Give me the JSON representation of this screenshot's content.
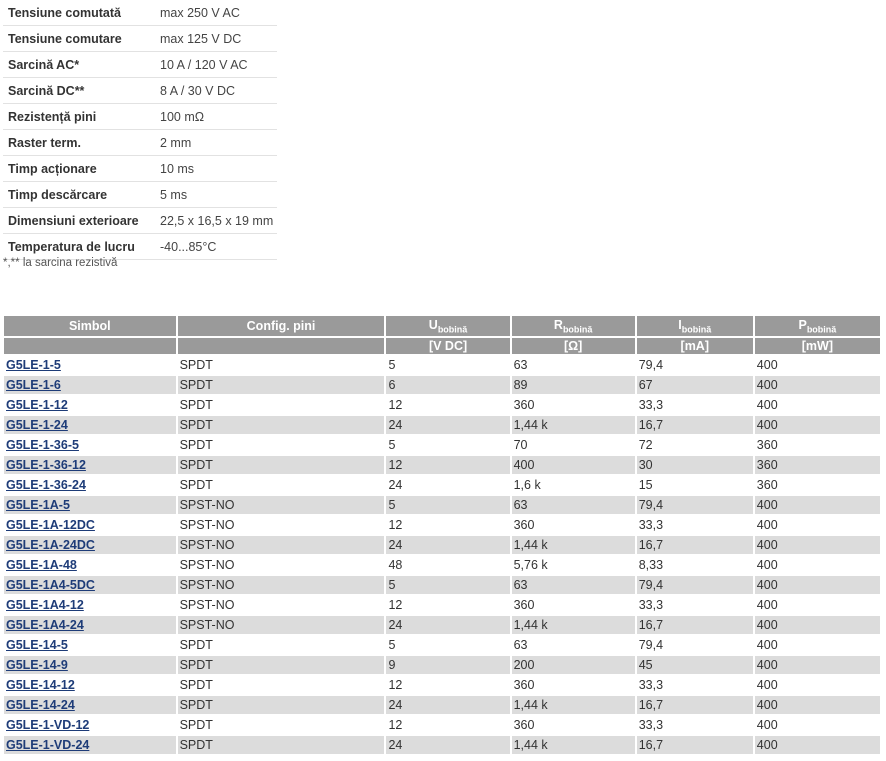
{
  "specs": [
    {
      "label": "Tensiune comutată",
      "value": "max 250 V AC"
    },
    {
      "label": "Tensiune comutare",
      "value": "max 125 V DC"
    },
    {
      "label": "Sarcină AC*",
      "value": "10 A / 120 V AC"
    },
    {
      "label": "Sarcină DC**",
      "value": "8 A / 30 V DC"
    },
    {
      "label": "Rezistență pini",
      "value": "100 mΩ"
    },
    {
      "label": "Raster term.",
      "value": "2 mm"
    },
    {
      "label": "Timp acționare",
      "value": "10 ms"
    },
    {
      "label": "Timp descărcare",
      "value": "5 ms"
    },
    {
      "label": "Dimensiuni exterioare",
      "value": "22,5 x 16,5 x 19 mm"
    },
    {
      "label": "Temperatura de lucru",
      "value": "-40...85°C"
    }
  ],
  "footnote": "*,** la sarcina rezistivă",
  "table": {
    "headers": {
      "symbol": "Simbol",
      "config": "Config. pini",
      "u": {
        "main": "U",
        "sub": "bobină",
        "unit": "[V DC]"
      },
      "r": {
        "main": "R",
        "sub": "bobină",
        "unit": "[Ω]"
      },
      "i": {
        "main": "I",
        "sub": "bobină",
        "unit": "[mA]"
      },
      "p": {
        "main": "P",
        "sub": "bobină",
        "unit": "[mW]"
      }
    },
    "rows": [
      {
        "symbol": "G5LE-1-5",
        "config": "SPDT",
        "u": "5",
        "r": "63",
        "i": "79,4",
        "p": "400"
      },
      {
        "symbol": "G5LE-1-6",
        "config": "SPDT",
        "u": "6",
        "r": "89",
        "i": "67",
        "p": "400"
      },
      {
        "symbol": "G5LE-1-12",
        "config": "SPDT",
        "u": "12",
        "r": "360",
        "i": "33,3",
        "p": "400"
      },
      {
        "symbol": "G5LE-1-24",
        "config": "SPDT",
        "u": "24",
        "r": "1,44 k",
        "i": "16,7",
        "p": "400"
      },
      {
        "symbol": "G5LE-1-36-5",
        "config": "SPDT",
        "u": "5",
        "r": "70",
        "i": "72",
        "p": "360"
      },
      {
        "symbol": "G5LE-1-36-12",
        "config": "SPDT",
        "u": "12",
        "r": "400",
        "i": "30",
        "p": "360"
      },
      {
        "symbol": "G5LE-1-36-24",
        "config": "SPDT",
        "u": "24",
        "r": "1,6 k",
        "i": "15",
        "p": "360"
      },
      {
        "symbol": "G5LE-1A-5",
        "config": "SPST-NO",
        "u": "5",
        "r": "63",
        "i": "79,4",
        "p": "400"
      },
      {
        "symbol": "G5LE-1A-12DC",
        "config": "SPST-NO",
        "u": "12",
        "r": "360",
        "i": "33,3",
        "p": "400"
      },
      {
        "symbol": "G5LE-1A-24DC",
        "config": "SPST-NO",
        "u": "24",
        "r": "1,44 k",
        "i": "16,7",
        "p": "400"
      },
      {
        "symbol": "G5LE-1A-48",
        "config": "SPST-NO",
        "u": "48",
        "r": "5,76 k",
        "i": "8,33",
        "p": "400"
      },
      {
        "symbol": "G5LE-1A4-5DC",
        "config": "SPST-NO",
        "u": "5",
        "r": "63",
        "i": "79,4",
        "p": "400"
      },
      {
        "symbol": "G5LE-1A4-12",
        "config": "SPST-NO",
        "u": "12",
        "r": "360",
        "i": "33,3",
        "p": "400"
      },
      {
        "symbol": "G5LE-1A4-24",
        "config": "SPST-NO",
        "u": "24",
        "r": "1,44 k",
        "i": "16,7",
        "p": "400"
      },
      {
        "symbol": "G5LE-14-5",
        "config": "SPDT",
        "u": "5",
        "r": "63",
        "i": "79,4",
        "p": "400"
      },
      {
        "symbol": "G5LE-14-9",
        "config": "SPDT",
        "u": "9",
        "r": "200",
        "i": "45",
        "p": "400"
      },
      {
        "symbol": "G5LE-14-12",
        "config": "SPDT",
        "u": "12",
        "r": "360",
        "i": "33,3",
        "p": "400"
      },
      {
        "symbol": "G5LE-14-24",
        "config": "SPDT",
        "u": "24",
        "r": "1,44 k",
        "i": "16,7",
        "p": "400"
      },
      {
        "symbol": "G5LE-1-VD-12",
        "config": "SPDT",
        "u": "12",
        "r": "360",
        "i": "33,3",
        "p": "400"
      },
      {
        "symbol": "G5LE-1-VD-24",
        "config": "SPDT",
        "u": "24",
        "r": "1,44 k",
        "i": "16,7",
        "p": "400"
      }
    ]
  }
}
